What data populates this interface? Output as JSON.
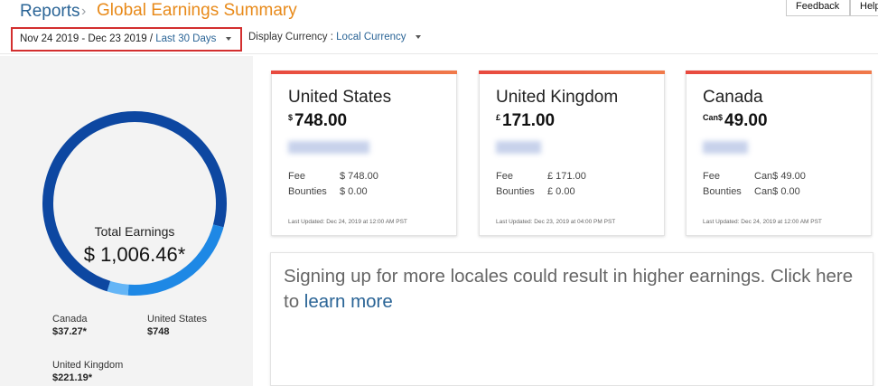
{
  "breadcrumb": {
    "reports": "Reports",
    "separator": "›",
    "title": "Global Earnings Summary"
  },
  "top_buttons": {
    "feedback": "Feedback",
    "help": "Help"
  },
  "filters": {
    "date_range": "Nov 24 2019 - Dec 23 2019",
    "date_slash": "/",
    "date_preset": "Last 30 Days",
    "currency_label": "Display Currency :",
    "currency_value": "Local Currency"
  },
  "summary": {
    "total_label": "Total Earnings",
    "total_value": "$ 1,006.46*",
    "legend": [
      {
        "name": "Canada",
        "value": "$37.27*"
      },
      {
        "name": "United States",
        "value": "$748"
      },
      {
        "name": "United Kingdom",
        "value": "$221.19*"
      }
    ]
  },
  "chart_data": {
    "type": "pie",
    "labels": [
      "United States",
      "United Kingdom",
      "Canada"
    ],
    "values": [
      748,
      221.19,
      37.27
    ],
    "colors": [
      "#0d47a1",
      "#1e88e5",
      "#64b5f6"
    ]
  },
  "cards": [
    {
      "name": "United States",
      "symbol": "$",
      "amount": "748.00",
      "fee_label": "Fee",
      "fee_value": "$ 748.00",
      "bounties_label": "Bounties",
      "bounties_value": "$ 0.00",
      "updated": "Last Updated: Dec 24, 2019 at 12:00 AM PST"
    },
    {
      "name": "United Kingdom",
      "symbol": "£",
      "amount": "171.00",
      "fee_label": "Fee",
      "fee_value": "£ 171.00",
      "bounties_label": "Bounties",
      "bounties_value": "£ 0.00",
      "updated": "Last Updated: Dec 23, 2019 at 04:00 PM PST"
    },
    {
      "name": "Canada",
      "symbol": "Can$",
      "amount": "49.00",
      "fee_label": "Fee",
      "fee_value": "Can$ 49.00",
      "bounties_label": "Bounties",
      "bounties_value": "Can$ 0.00",
      "updated": "Last Updated: Dec 24, 2019 at 12:00 AM PST"
    }
  ],
  "promo": {
    "text": "Signing up for more locales could result in higher earnings. Click here to ",
    "link": "learn more"
  }
}
